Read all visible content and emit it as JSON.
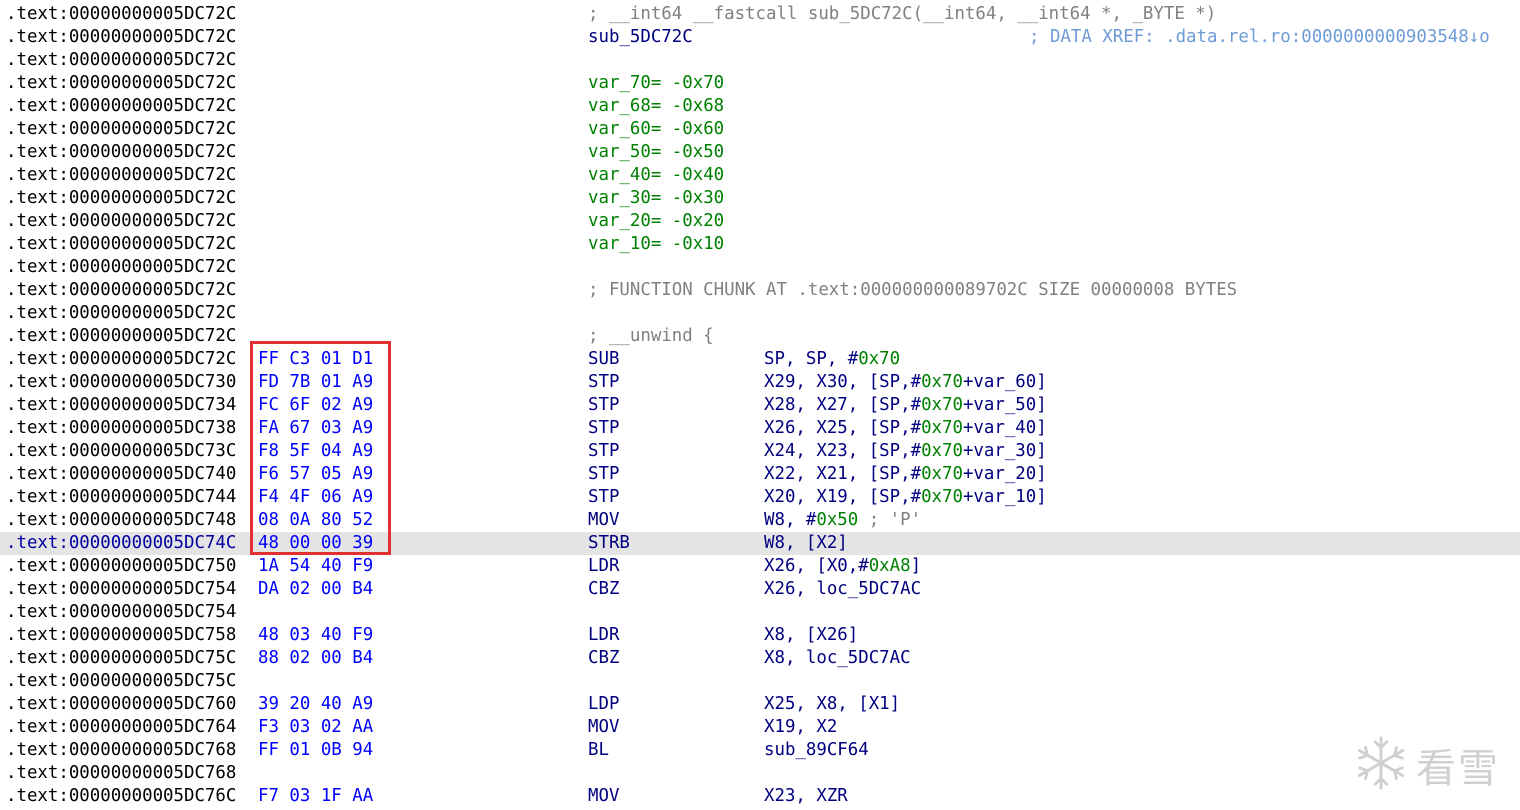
{
  "watermark": {
    "text": "看雪",
    "icon": "snowflake-icon"
  },
  "colors": {
    "bytes": "#0000ff",
    "highlight": "#e4e4e4",
    "box": "#e03030",
    "var": "#008000"
  },
  "lines": [
    {
      "addr": ".text:00000000005DC72C",
      "bytes": "",
      "kind": "comment",
      "text": "; __int64 __fastcall sub_5DC72C(__int64, __int64 *, _BYTE *)"
    },
    {
      "addr": ".text:00000000005DC72C",
      "bytes": "",
      "kind": "label",
      "text": "sub_5DC72C",
      "xref": "; DATA XREF: .data.rel.ro:0000000000903548↓o"
    },
    {
      "addr": ".text:00000000005DC72C",
      "bytes": "",
      "kind": "blank"
    },
    {
      "addr": ".text:00000000005DC72C",
      "bytes": "",
      "kind": "var",
      "name": "var_70=",
      "value": "-0x70"
    },
    {
      "addr": ".text:00000000005DC72C",
      "bytes": "",
      "kind": "var",
      "name": "var_68=",
      "value": "-0x68"
    },
    {
      "addr": ".text:00000000005DC72C",
      "bytes": "",
      "kind": "var",
      "name": "var_60=",
      "value": "-0x60"
    },
    {
      "addr": ".text:00000000005DC72C",
      "bytes": "",
      "kind": "var",
      "name": "var_50=",
      "value": "-0x50"
    },
    {
      "addr": ".text:00000000005DC72C",
      "bytes": "",
      "kind": "var",
      "name": "var_40=",
      "value": "-0x40"
    },
    {
      "addr": ".text:00000000005DC72C",
      "bytes": "",
      "kind": "var",
      "name": "var_30=",
      "value": "-0x30"
    },
    {
      "addr": ".text:00000000005DC72C",
      "bytes": "",
      "kind": "var",
      "name": "var_20=",
      "value": "-0x20"
    },
    {
      "addr": ".text:00000000005DC72C",
      "bytes": "",
      "kind": "var",
      "name": "var_10=",
      "value": "-0x10"
    },
    {
      "addr": ".text:00000000005DC72C",
      "bytes": "",
      "kind": "blank"
    },
    {
      "addr": ".text:00000000005DC72C",
      "bytes": "",
      "kind": "comment",
      "text": "; FUNCTION CHUNK AT .text:000000000089702C SIZE 00000008 BYTES"
    },
    {
      "addr": ".text:00000000005DC72C",
      "bytes": "",
      "kind": "blank"
    },
    {
      "addr": ".text:00000000005DC72C",
      "bytes": "",
      "kind": "comment",
      "text": "; __unwind {"
    },
    {
      "addr": ".text:00000000005DC72C",
      "bytes": "FF C3 01 D1",
      "kind": "insn",
      "mnem": "SUB",
      "ops": [
        [
          "SP, SP, #",
          "o"
        ],
        [
          "0x70",
          "n"
        ]
      ]
    },
    {
      "addr": ".text:00000000005DC730",
      "bytes": "FD 7B 01 A9",
      "kind": "insn",
      "mnem": "STP",
      "ops": [
        [
          "X29, X30, [SP,#",
          "o"
        ],
        [
          "0x70",
          "n"
        ],
        [
          "+var_60]",
          "o"
        ]
      ]
    },
    {
      "addr": ".text:00000000005DC734",
      "bytes": "FC 6F 02 A9",
      "kind": "insn",
      "mnem": "STP",
      "ops": [
        [
          "X28, X27, [SP,#",
          "o"
        ],
        [
          "0x70",
          "n"
        ],
        [
          "+var_50]",
          "o"
        ]
      ]
    },
    {
      "addr": ".text:00000000005DC738",
      "bytes": "FA 67 03 A9",
      "kind": "insn",
      "mnem": "STP",
      "ops": [
        [
          "X26, X25, [SP,#",
          "o"
        ],
        [
          "0x70",
          "n"
        ],
        [
          "+var_40]",
          "o"
        ]
      ]
    },
    {
      "addr": ".text:00000000005DC73C",
      "bytes": "F8 5F 04 A9",
      "kind": "insn",
      "mnem": "STP",
      "ops": [
        [
          "X24, X23, [SP,#",
          "o"
        ],
        [
          "0x70",
          "n"
        ],
        [
          "+var_30]",
          "o"
        ]
      ]
    },
    {
      "addr": ".text:00000000005DC740",
      "bytes": "F6 57 05 A9",
      "kind": "insn",
      "mnem": "STP",
      "ops": [
        [
          "X22, X21, [SP,#",
          "o"
        ],
        [
          "0x70",
          "n"
        ],
        [
          "+var_20]",
          "o"
        ]
      ]
    },
    {
      "addr": ".text:00000000005DC744",
      "bytes": "F4 4F 06 A9",
      "kind": "insn",
      "mnem": "STP",
      "ops": [
        [
          "X20, X19, [SP,#",
          "o"
        ],
        [
          "0x70",
          "n"
        ],
        [
          "+var_10]",
          "o"
        ]
      ]
    },
    {
      "addr": ".text:00000000005DC748",
      "bytes": "08 0A 80 52",
      "kind": "insn",
      "mnem": "MOV",
      "ops": [
        [
          "W8, #",
          "o"
        ],
        [
          "0x50",
          "n"
        ],
        [
          " ; 'P'",
          "c"
        ]
      ]
    },
    {
      "addr": ".text:00000000005DC74C",
      "bytes": "48 00 00 39",
      "kind": "insn",
      "mnem": "STRB",
      "ops": [
        [
          "W8, [X2]",
          "o"
        ]
      ],
      "highlight": true
    },
    {
      "addr": ".text:00000000005DC750",
      "bytes": "1A 54 40 F9",
      "kind": "insn",
      "mnem": "LDR",
      "ops": [
        [
          "X26, [X0,#",
          "o"
        ],
        [
          "0xA8",
          "n"
        ],
        [
          "]",
          "o"
        ]
      ]
    },
    {
      "addr": ".text:00000000005DC754",
      "bytes": "DA 02 00 B4",
      "kind": "insn",
      "mnem": "CBZ",
      "ops": [
        [
          "X26, loc_5DC7AC",
          "o"
        ]
      ]
    },
    {
      "addr": ".text:00000000005DC754",
      "bytes": "",
      "kind": "blank"
    },
    {
      "addr": ".text:00000000005DC758",
      "bytes": "48 03 40 F9",
      "kind": "insn",
      "mnem": "LDR",
      "ops": [
        [
          "X8, [X26]",
          "o"
        ]
      ]
    },
    {
      "addr": ".text:00000000005DC75C",
      "bytes": "88 02 00 B4",
      "kind": "insn",
      "mnem": "CBZ",
      "ops": [
        [
          "X8, loc_5DC7AC",
          "o"
        ]
      ]
    },
    {
      "addr": ".text:00000000005DC75C",
      "bytes": "",
      "kind": "blank"
    },
    {
      "addr": ".text:00000000005DC760",
      "bytes": "39 20 40 A9",
      "kind": "insn",
      "mnem": "LDP",
      "ops": [
        [
          "X25, X8, [X1]",
          "o"
        ]
      ]
    },
    {
      "addr": ".text:00000000005DC764",
      "bytes": "F3 03 02 AA",
      "kind": "insn",
      "mnem": "MOV",
      "ops": [
        [
          "X19, X2",
          "o"
        ]
      ]
    },
    {
      "addr": ".text:00000000005DC768",
      "bytes": "FF 01 0B 94",
      "kind": "insn",
      "mnem": "BL",
      "ops": [
        [
          "sub_89CF64",
          "o"
        ]
      ]
    },
    {
      "addr": ".text:00000000005DC768",
      "bytes": "",
      "kind": "blank"
    },
    {
      "addr": ".text:00000000005DC76C",
      "bytes": "F7 03 1F AA",
      "kind": "insn",
      "mnem": "MOV",
      "ops": [
        [
          "X23, XZR",
          "o"
        ]
      ]
    }
  ]
}
